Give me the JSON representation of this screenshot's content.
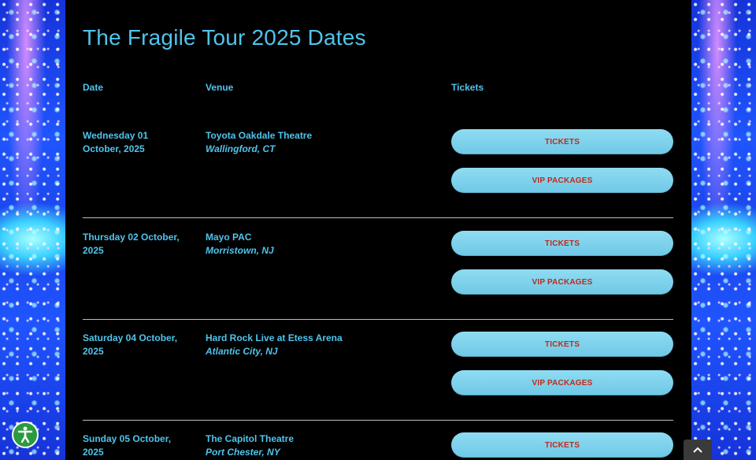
{
  "page": {
    "title": "The Fragile Tour 2025 Dates",
    "headers": {
      "date": "Date",
      "venue": "Venue",
      "tickets": "Tickets"
    }
  },
  "events": [
    {
      "date": "Wednesday 01 October, 2025",
      "venue": "Toyota Oakdale Theatre",
      "location": "Wallingford, CT",
      "tickets_label": "TICKETS",
      "vip_label": "VIP PACKAGES"
    },
    {
      "date": "Thursday 02 October, 2025",
      "venue": "Mayo PAC",
      "location": "Morristown, NJ",
      "tickets_label": "TICKETS",
      "vip_label": "VIP PACKAGES"
    },
    {
      "date": "Saturday 04 October, 2025",
      "venue": "Hard Rock Live at Etess Arena",
      "location": "Atlantic City, NJ",
      "tickets_label": "TICKETS",
      "vip_label": "VIP PACKAGES"
    },
    {
      "date": "Sunday 05 October, 2025",
      "venue": "The Capitol Theatre",
      "location": "Port Chester, NY",
      "tickets_label": "TICKETS"
    }
  ],
  "icons": {
    "accessibility": "accessibility-icon",
    "scroll_top": "chevron-up-icon"
  },
  "colors": {
    "accent": "#4fc4ec",
    "button_bg": "#7ccfe9",
    "button_text": "#c02a1a",
    "accessibility_bg": "#2a9b3f"
  }
}
